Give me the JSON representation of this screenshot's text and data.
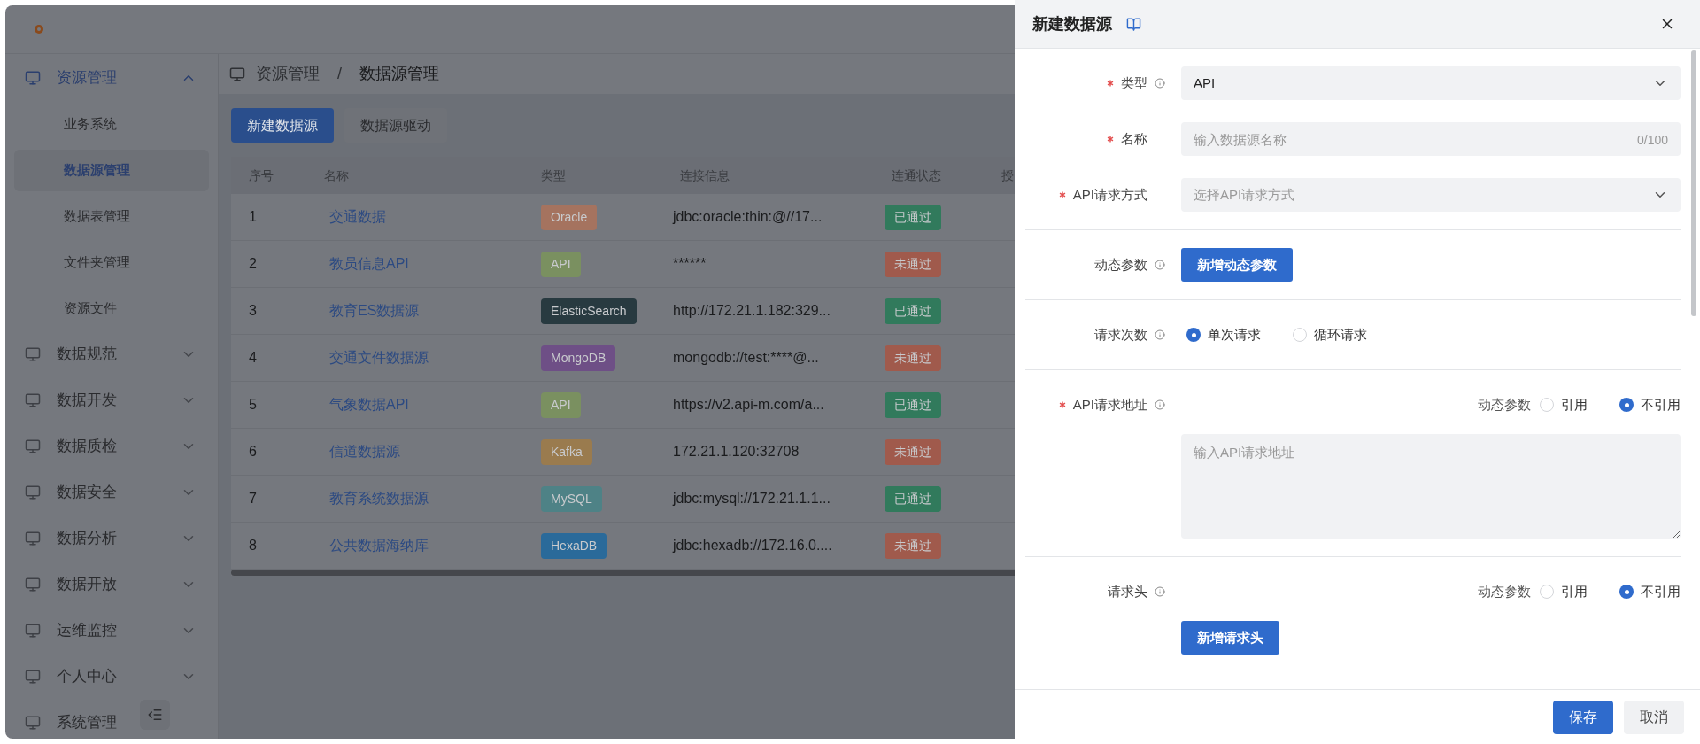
{
  "sidebar": {
    "items": [
      {
        "label": "资源管理",
        "expanded": true,
        "children": [
          {
            "label": "业务系统",
            "selected": false
          },
          {
            "label": "数据源管理",
            "selected": true
          },
          {
            "label": "数据表管理",
            "selected": false
          },
          {
            "label": "文件夹管理",
            "selected": false
          },
          {
            "label": "资源文件",
            "selected": false
          }
        ]
      },
      {
        "label": "数据规范",
        "expanded": false
      },
      {
        "label": "数据开发",
        "expanded": false
      },
      {
        "label": "数据质检",
        "expanded": false
      },
      {
        "label": "数据安全",
        "expanded": false
      },
      {
        "label": "数据分析",
        "expanded": false
      },
      {
        "label": "数据开放",
        "expanded": false
      },
      {
        "label": "运维监控",
        "expanded": false
      },
      {
        "label": "个人中心",
        "expanded": false
      },
      {
        "label": "系统管理",
        "expanded": false
      }
    ]
  },
  "breadcrumb": [
    "资源管理",
    "/",
    "数据源管理"
  ],
  "toolbar": {
    "buttons": [
      {
        "label": "新建数据源",
        "kind": "primary"
      },
      {
        "label": "数据源驱动",
        "kind": "default"
      }
    ]
  },
  "table": {
    "columns": [
      "序号",
      "名称",
      "类型",
      "连接信息",
      "连通状态",
      "授"
    ],
    "rows": [
      {
        "index": "1",
        "name": "交通数据",
        "type": {
          "label": "Oracle",
          "color": "#a5735f"
        },
        "connection": "jdbc:oracle:thin:@//17...",
        "status": {
          "label": "已通过",
          "color": "#317a5c"
        }
      },
      {
        "index": "2",
        "name": "教员信息API",
        "type": {
          "label": "API",
          "color": "#7a9060"
        },
        "connection": "******",
        "status": {
          "label": "未通过",
          "color": "#a05a4c"
        }
      },
      {
        "index": "3",
        "name": "教育ES数据源",
        "type": {
          "label": "ElasticSearch",
          "color": "#283a40"
        },
        "connection": "http://172.21.1.182:329...",
        "status": {
          "label": "已通过",
          "color": "#317a5c"
        }
      },
      {
        "index": "4",
        "name": "交通文件数据源",
        "type": {
          "label": "MongoDB",
          "color": "#6e4f86"
        },
        "connection": "mongodb://test:****@...",
        "status": {
          "label": "未通过",
          "color": "#a05a4c"
        }
      },
      {
        "index": "5",
        "name": "气象数据API",
        "type": {
          "label": "API",
          "color": "#7a9060"
        },
        "connection": "https://v2.api-m.com/a...",
        "status": {
          "label": "已通过",
          "color": "#317a5c"
        }
      },
      {
        "index": "6",
        "name": "信道数据源",
        "type": {
          "label": "Kafka",
          "color": "#9a7b4e"
        },
        "connection": "172.21.1.120:32708",
        "status": {
          "label": "未通过",
          "color": "#a05a4c"
        }
      },
      {
        "index": "7",
        "name": "教育系统数据源",
        "type": {
          "label": "MySQL",
          "color": "#4e8286"
        },
        "connection": "jdbc:mysql://172.21.1.1...",
        "status": {
          "label": "已通过",
          "color": "#317a5c"
        }
      },
      {
        "index": "8",
        "name": "公共数据海纳库",
        "type": {
          "label": "HexaDB",
          "color": "#2a6a9a"
        },
        "connection": "jdbc:hexadb://172.16.0....",
        "status": {
          "label": "未通过",
          "color": "#a05a4c"
        }
      }
    ]
  },
  "drawer": {
    "title": "新建数据源",
    "sections": [
      [
        {
          "kind": "select",
          "label": "类型",
          "required": true,
          "info": true,
          "value": "API"
        },
        {
          "kind": "input",
          "label": "名称",
          "required": true,
          "info": false,
          "placeholder": "输入数据源名称",
          "counter": "0/100"
        },
        {
          "kind": "select",
          "label": "API请求方式",
          "required": true,
          "info": false,
          "placeholder": "选择API请求方式"
        }
      ],
      [
        {
          "kind": "button",
          "label": "动态参数",
          "required": false,
          "info": true,
          "button": "新增动态参数"
        }
      ],
      [
        {
          "kind": "radio",
          "label": "请求次数",
          "required": false,
          "info": true,
          "options": [
            {
              "label": "单次请求",
              "selected": true
            },
            {
              "label": "循环请求",
              "selected": false
            }
          ]
        }
      ],
      [
        {
          "kind": "textarea",
          "label": "API请求地址",
          "required": true,
          "info": true,
          "placeholder": "输入API请求地址",
          "switch": {
            "label": "动态参数",
            "options": [
              {
                "label": "引用",
                "selected": false
              },
              {
                "label": "不引用",
                "selected": true
              }
            ]
          }
        }
      ],
      [
        {
          "kind": "button",
          "label": "请求头",
          "required": false,
          "info": true,
          "button": "新增请求头",
          "switch": {
            "label": "动态参数",
            "options": [
              {
                "label": "引用",
                "selected": false
              },
              {
                "label": "不引用",
                "selected": true
              }
            ]
          }
        }
      ]
    ],
    "footer": [
      {
        "label": "保存",
        "kind": "primary"
      },
      {
        "label": "取消",
        "kind": "default"
      }
    ]
  }
}
